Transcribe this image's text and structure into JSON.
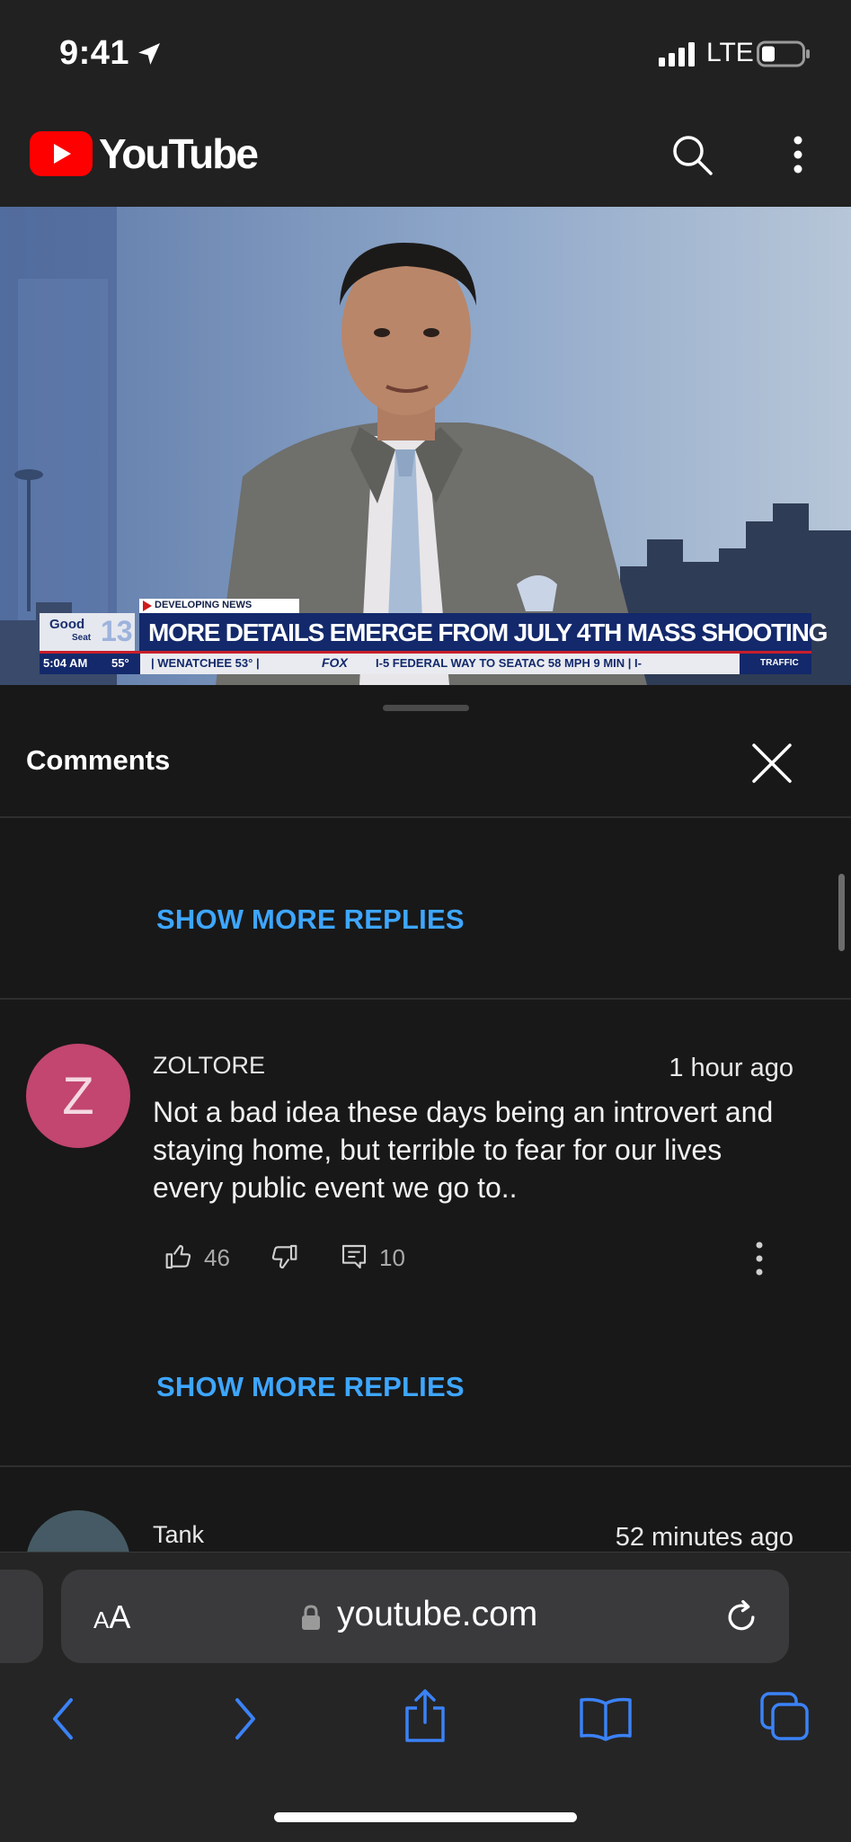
{
  "status_bar": {
    "time": "9:41",
    "network": "LTE",
    "icons": [
      "location-arrow-icon",
      "signal-bars-icon",
      "battery-icon"
    ]
  },
  "youtube_header": {
    "brand": "YouTube",
    "icons": [
      "youtube-play-logo",
      "search-icon",
      "more-vert-icon"
    ]
  },
  "video": {
    "lower_third": {
      "tag": "DEVELOPING NEWS",
      "headline": "MORE DETAILS EMERGE FROM JULY 4TH MASS SHOOTING",
      "station_top": "Good",
      "station_bottom": "Seat",
      "channel": "13",
      "time": "5:04 AM",
      "temp": "55°",
      "ticker": "| WENATCHEE 53° |",
      "network": "FOX",
      "traffic": "I-5 FEDERAL WAY TO SEATAC 58 MPH 9 MIN | I-",
      "traffic_label": "TRAFFIC"
    }
  },
  "comments_panel": {
    "title": "Comments",
    "show_more_replies": "SHOW MORE REPLIES",
    "comments": [
      {
        "avatar_letter": "Z",
        "author": "ZOLTORE",
        "time": "1 hour ago",
        "text": "Not a bad idea these days being an introvert and staying home, but terrible to fear for our lives every public event we go to..",
        "likes": "46",
        "replies": "10"
      },
      {
        "author": "Tank",
        "time": "52 minutes ago"
      }
    ]
  },
  "browser": {
    "text_size_small": "A",
    "text_size_large": "A",
    "url": "youtube.com",
    "toolbar_icons": [
      "back-icon",
      "forward-icon",
      "share-icon",
      "bookmarks-icon",
      "tabs-icon"
    ]
  },
  "colors": {
    "background": "#181818",
    "header": "#212121",
    "accent_link": "#3ea6ff",
    "youtube_red": "#ff0000",
    "safari_blue": "#3b82f6",
    "avatar_z": "#c2466f"
  }
}
